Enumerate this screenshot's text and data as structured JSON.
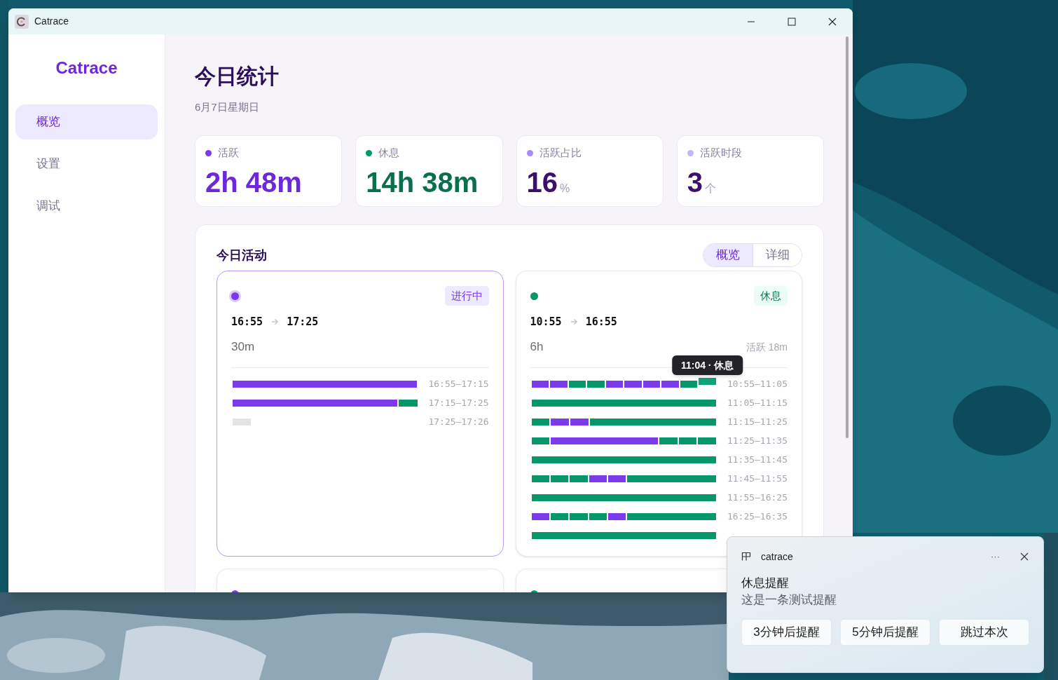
{
  "window": {
    "title": "Catrace"
  },
  "sidebar": {
    "logo": "Catrace",
    "items": [
      {
        "label": "概览",
        "selected": true
      },
      {
        "label": "设置",
        "selected": false
      },
      {
        "label": "调试",
        "selected": false
      }
    ]
  },
  "header": {
    "title": "今日统计",
    "date": "6月7日星期日"
  },
  "stats": [
    {
      "kind": "active",
      "label": "活跃",
      "color": "#7c3aed",
      "value": "2h 48m"
    },
    {
      "kind": "rest",
      "label": "休息",
      "color": "#059669",
      "value": "14h 38m"
    },
    {
      "kind": "ratio",
      "label": "活跃占比",
      "color": "#a78bfa",
      "value": "16",
      "unit": "%"
    },
    {
      "kind": "count",
      "label": "活跃时段",
      "color": "#c4b5fd",
      "value": "3",
      "unit": "个"
    }
  ],
  "activity": {
    "title": "今日活动",
    "view_tabs": [
      {
        "label": "概览",
        "selected": true
      },
      {
        "label": "详细",
        "selected": false
      }
    ],
    "sessions": [
      {
        "kind": "active",
        "selected": true,
        "ongoing": true,
        "badge": "进行中",
        "start": "16:55",
        "end": "17:25",
        "duration": "30m",
        "rows": [
          {
            "range": "16:55–17:15",
            "slots": [
              {
                "kind": "active",
                "joined": false,
                "hovered": false
              },
              {
                "kind": "active",
                "joined": true,
                "hovered": false
              },
              {
                "kind": "active",
                "joined": true,
                "hovered": false
              },
              {
                "kind": "active",
                "joined": true,
                "hovered": false
              },
              {
                "kind": "active",
                "joined": true,
                "hovered": false
              },
              {
                "kind": "active",
                "joined": true,
                "hovered": false
              },
              {
                "kind": "active",
                "joined": true,
                "hovered": false
              },
              {
                "kind": "active",
                "joined": true,
                "hovered": false
              },
              {
                "kind": "active",
                "joined": true,
                "hovered": false
              },
              {
                "kind": "active",
                "joined": true,
                "hovered": false
              }
            ]
          },
          {
            "range": "17:15–17:25",
            "slots": [
              {
                "kind": "active",
                "joined": false,
                "hovered": false
              },
              {
                "kind": "active",
                "joined": true,
                "hovered": false
              },
              {
                "kind": "active",
                "joined": true,
                "hovered": false
              },
              {
                "kind": "active",
                "joined": true,
                "hovered": false
              },
              {
                "kind": "active",
                "joined": true,
                "hovered": false
              },
              {
                "kind": "active",
                "joined": true,
                "hovered": false
              },
              {
                "kind": "active",
                "joined": true,
                "hovered": false
              },
              {
                "kind": "active",
                "joined": true,
                "hovered": false
              },
              {
                "kind": "active",
                "joined": true,
                "hovered": false
              },
              {
                "kind": "rest",
                "joined": false,
                "hovered": false
              }
            ]
          },
          {
            "range": "17:25–17:26",
            "slots": [
              {
                "kind": "pending",
                "joined": false,
                "hovered": false
              }
            ]
          }
        ]
      },
      {
        "kind": "rest",
        "selected": false,
        "ongoing": false,
        "badge": "休息",
        "start": "10:55",
        "end": "16:55",
        "duration": "6h",
        "summary": "活跃 18m",
        "rows": [
          {
            "range": "10:55–11:05",
            "slots": [
              {
                "kind": "active",
                "joined": false,
                "hovered": false
              },
              {
                "kind": "active",
                "joined": false,
                "hovered": false
              },
              {
                "kind": "rest",
                "joined": false,
                "hovered": false
              },
              {
                "kind": "rest",
                "joined": false,
                "hovered": false
              },
              {
                "kind": "active",
                "joined": false,
                "hovered": false
              },
              {
                "kind": "active",
                "joined": false,
                "hovered": false
              },
              {
                "kind": "active",
                "joined": false,
                "hovered": false
              },
              {
                "kind": "active",
                "joined": false,
                "hovered": false
              },
              {
                "kind": "rest",
                "joined": false,
                "hovered": false
              },
              {
                "kind": "rest",
                "joined": false,
                "hovered": true,
                "tooltip": "11:04 · 休息"
              }
            ]
          },
          {
            "range": "11:05–11:15",
            "slots": [
              {
                "kind": "rest",
                "joined": false,
                "hovered": false
              },
              {
                "kind": "rest",
                "joined": true,
                "hovered": false
              },
              {
                "kind": "rest",
                "joined": true,
                "hovered": false
              },
              {
                "kind": "rest",
                "joined": true,
                "hovered": false
              },
              {
                "kind": "rest",
                "joined": true,
                "hovered": false
              },
              {
                "kind": "rest",
                "joined": true,
                "hovered": false
              },
              {
                "kind": "rest",
                "joined": true,
                "hovered": false
              },
              {
                "kind": "rest",
                "joined": true,
                "hovered": false
              },
              {
                "kind": "rest",
                "joined": true,
                "hovered": false
              },
              {
                "kind": "rest",
                "joined": true,
                "hovered": false
              }
            ]
          },
          {
            "range": "11:15–11:25",
            "slots": [
              {
                "kind": "rest",
                "joined": false,
                "hovered": false
              },
              {
                "kind": "active",
                "joined": false,
                "hovered": false
              },
              {
                "kind": "active",
                "joined": false,
                "hovered": false
              },
              {
                "kind": "rest",
                "joined": false,
                "hovered": false
              },
              {
                "kind": "rest",
                "joined": true,
                "hovered": false
              },
              {
                "kind": "rest",
                "joined": true,
                "hovered": false
              },
              {
                "kind": "rest",
                "joined": true,
                "hovered": false
              },
              {
                "kind": "rest",
                "joined": true,
                "hovered": false
              },
              {
                "kind": "rest",
                "joined": true,
                "hovered": false
              },
              {
                "kind": "rest",
                "joined": true,
                "hovered": false
              }
            ]
          },
          {
            "range": "11:25–11:35",
            "slots": [
              {
                "kind": "rest",
                "joined": false,
                "hovered": false
              },
              {
                "kind": "active",
                "joined": false,
                "hovered": false
              },
              {
                "kind": "active",
                "joined": true,
                "hovered": false
              },
              {
                "kind": "active",
                "joined": true,
                "hovered": false
              },
              {
                "kind": "active",
                "joined": true,
                "hovered": false
              },
              {
                "kind": "active",
                "joined": true,
                "hovered": false
              },
              {
                "kind": "active",
                "joined": true,
                "hovered": false
              },
              {
                "kind": "rest",
                "joined": false,
                "hovered": false
              },
              {
                "kind": "rest",
                "joined": false,
                "hovered": false
              },
              {
                "kind": "rest",
                "joined": false,
                "hovered": false
              }
            ]
          },
          {
            "range": "11:35–11:45",
            "slots": [
              {
                "kind": "rest",
                "joined": false,
                "hovered": false
              },
              {
                "kind": "rest",
                "joined": true,
                "hovered": false
              },
              {
                "kind": "rest",
                "joined": true,
                "hovered": false
              },
              {
                "kind": "rest",
                "joined": true,
                "hovered": false
              },
              {
                "kind": "rest",
                "joined": true,
                "hovered": false
              },
              {
                "kind": "rest",
                "joined": true,
                "hovered": false
              },
              {
                "kind": "rest",
                "joined": true,
                "hovered": false
              },
              {
                "kind": "rest",
                "joined": true,
                "hovered": false
              },
              {
                "kind": "rest",
                "joined": true,
                "hovered": false
              },
              {
                "kind": "rest",
                "joined": true,
                "hovered": false
              }
            ]
          },
          {
            "range": "11:45–11:55",
            "slots": [
              {
                "kind": "rest",
                "joined": false,
                "hovered": false
              },
              {
                "kind": "rest",
                "joined": false,
                "hovered": false
              },
              {
                "kind": "rest",
                "joined": false,
                "hovered": false
              },
              {
                "kind": "active",
                "joined": false,
                "hovered": false
              },
              {
                "kind": "active",
                "joined": false,
                "hovered": false
              },
              {
                "kind": "rest",
                "joined": false,
                "hovered": false
              },
              {
                "kind": "rest",
                "joined": true,
                "hovered": false
              },
              {
                "kind": "rest",
                "joined": true,
                "hovered": false
              },
              {
                "kind": "rest",
                "joined": true,
                "hovered": false
              },
              {
                "kind": "rest",
                "joined": true,
                "hovered": false
              }
            ]
          },
          {
            "range": "11:55–16:25",
            "slots": [
              {
                "kind": "rest",
                "joined": false,
                "hovered": false
              },
              {
                "kind": "rest",
                "joined": true,
                "hovered": false
              },
              {
                "kind": "rest",
                "joined": true,
                "hovered": false
              },
              {
                "kind": "rest",
                "joined": true,
                "hovered": false
              },
              {
                "kind": "rest",
                "joined": true,
                "hovered": false
              },
              {
                "kind": "rest",
                "joined": true,
                "hovered": false
              },
              {
                "kind": "rest",
                "joined": true,
                "hovered": false
              },
              {
                "kind": "rest",
                "joined": true,
                "hovered": false
              },
              {
                "kind": "rest",
                "joined": true,
                "hovered": false
              },
              {
                "kind": "rest",
                "joined": true,
                "hovered": false
              }
            ]
          },
          {
            "range": "16:25–16:35",
            "slots": [
              {
                "kind": "active",
                "joined": false,
                "hovered": false
              },
              {
                "kind": "rest",
                "joined": false,
                "hovered": false
              },
              {
                "kind": "rest",
                "joined": false,
                "hovered": false
              },
              {
                "kind": "rest",
                "joined": false,
                "hovered": false
              },
              {
                "kind": "active",
                "joined": false,
                "hovered": false
              },
              {
                "kind": "rest",
                "joined": false,
                "hovered": false
              },
              {
                "kind": "rest",
                "joined": true,
                "hovered": false
              },
              {
                "kind": "rest",
                "joined": true,
                "hovered": false
              },
              {
                "kind": "rest",
                "joined": true,
                "hovered": false
              },
              {
                "kind": "rest",
                "joined": true,
                "hovered": false
              }
            ]
          },
          {
            "slots": [
              {
                "kind": "rest",
                "joined": false,
                "hovered": false
              },
              {
                "kind": "rest",
                "joined": true,
                "hovered": false
              },
              {
                "kind": "rest",
                "joined": true,
                "hovered": false
              },
              {
                "kind": "rest",
                "joined": true,
                "hovered": false
              },
              {
                "kind": "rest",
                "joined": true,
                "hovered": false
              },
              {
                "kind": "rest",
                "joined": true,
                "hovered": false
              },
              {
                "kind": "rest",
                "joined": true,
                "hovered": false
              },
              {
                "kind": "rest",
                "joined": true,
                "hovered": false
              },
              {
                "kind": "rest",
                "joined": true,
                "hovered": false
              },
              {
                "kind": "rest",
                "joined": true,
                "hovered": false
              }
            ]
          }
        ]
      },
      {
        "kind": "active",
        "selected": false,
        "ongoing": false
      },
      {
        "kind": "rest",
        "selected": false,
        "ongoing": false
      }
    ]
  },
  "notification": {
    "app": "catrace",
    "title": "休息提醒",
    "body": "这是一条测试提醒",
    "more": "···",
    "buttons": [
      "3分钟后提醒",
      "5分钟后提醒",
      "跳过本次"
    ]
  }
}
